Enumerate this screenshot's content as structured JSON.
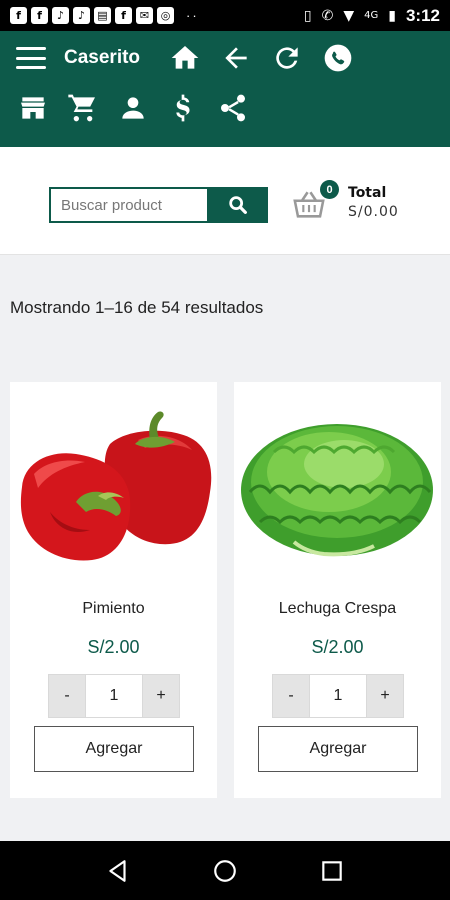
{
  "status_bar": {
    "left_icons": [
      "facebook-icon",
      "facebook-icon",
      "tiktok-icon",
      "tiktok-icon",
      "document-icon",
      "facebook-icon",
      "mail-icon",
      "instagram-icon"
    ],
    "overflow": "··",
    "network": "4G",
    "time": "3:12"
  },
  "header": {
    "brand": "Caserito",
    "nav_icons": [
      "home-icon",
      "back-arrow-icon",
      "refresh-icon",
      "whatsapp-icon"
    ],
    "tool_icons": [
      "store-icon",
      "cart-icon",
      "user-icon",
      "dollar-icon",
      "share-icon"
    ]
  },
  "search": {
    "placeholder": "Buscar product"
  },
  "cart": {
    "count": "0",
    "total_label": "Total",
    "total_value": "S/0.00"
  },
  "results_text": "Mostrando 1–16 de 54 resultados",
  "products": [
    {
      "name": "Pimiento",
      "price": "S/2.00",
      "qty": "1",
      "minus": "-",
      "plus": "+",
      "add_label": "Agregar"
    },
    {
      "name": "Lechuga Crespa",
      "price": "S/2.00",
      "qty": "1",
      "minus": "-",
      "plus": "+",
      "add_label": "Agregar"
    }
  ],
  "colors": {
    "primary": "#0d5a4a",
    "background": "#f0f1f3"
  }
}
